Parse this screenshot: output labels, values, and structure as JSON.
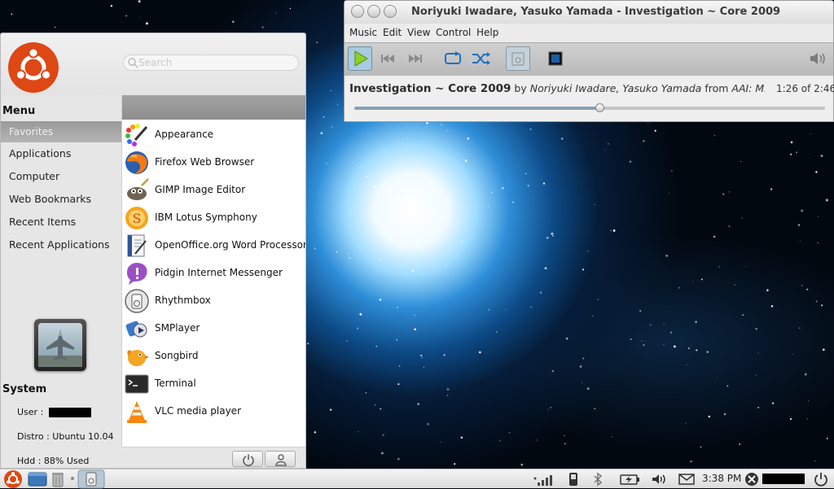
{
  "menu": {
    "search_placeholder": "Search",
    "section_title": "Menu",
    "favorites_label": "Favorites",
    "categories": [
      "Applications",
      "Computer",
      "Web Bookmarks",
      "Recent Items",
      "Recent Applications"
    ],
    "system_title": "System",
    "user_label": "User :",
    "distro_label": "Distro : Ubuntu 10.04",
    "hdd_label": "Hdd : 88% Used",
    "apps": [
      {
        "label": "Appearance",
        "icon": "appearance-icon"
      },
      {
        "label": "Firefox Web Browser",
        "icon": "firefox-icon"
      },
      {
        "label": "GIMP Image Editor",
        "icon": "gimp-icon"
      },
      {
        "label": "IBM Lotus Symphony",
        "icon": "lotus-symphony-icon"
      },
      {
        "label": "OpenOffice.org Word Processor",
        "icon": "openoffice-writer-icon"
      },
      {
        "label": "Pidgin Internet Messenger",
        "icon": "pidgin-icon"
      },
      {
        "label": "Rhythmbox",
        "icon": "rhythmbox-icon"
      },
      {
        "label": "SMPlayer",
        "icon": "smplayer-icon"
      },
      {
        "label": "Songbird",
        "icon": "songbird-icon"
      },
      {
        "label": "Terminal",
        "icon": "terminal-icon"
      },
      {
        "label": "VLC media player",
        "icon": "vlc-icon"
      }
    ]
  },
  "player": {
    "window_title": "Noriyuki Iwadare, Yasuko Yamada - Investigation ~ Core 2009",
    "menus": [
      "Music",
      "Edit",
      "View",
      "Control",
      "Help"
    ],
    "track_title": "Investigation ~ Core 2009",
    "by_word": "by",
    "artist": "Noriyuki Iwadare, Yasuko Yamada",
    "from_word": "from",
    "album": "AAI: Miles Edgew...",
    "time": "1:26 of 2:46",
    "progress": 0.52
  },
  "panel": {
    "clock": "3:38 PM"
  },
  "colors": {
    "ubuntu_orange": "#dd4814",
    "menu_bg": "#e6e6e6",
    "space_blue": "#2f8ed8"
  }
}
